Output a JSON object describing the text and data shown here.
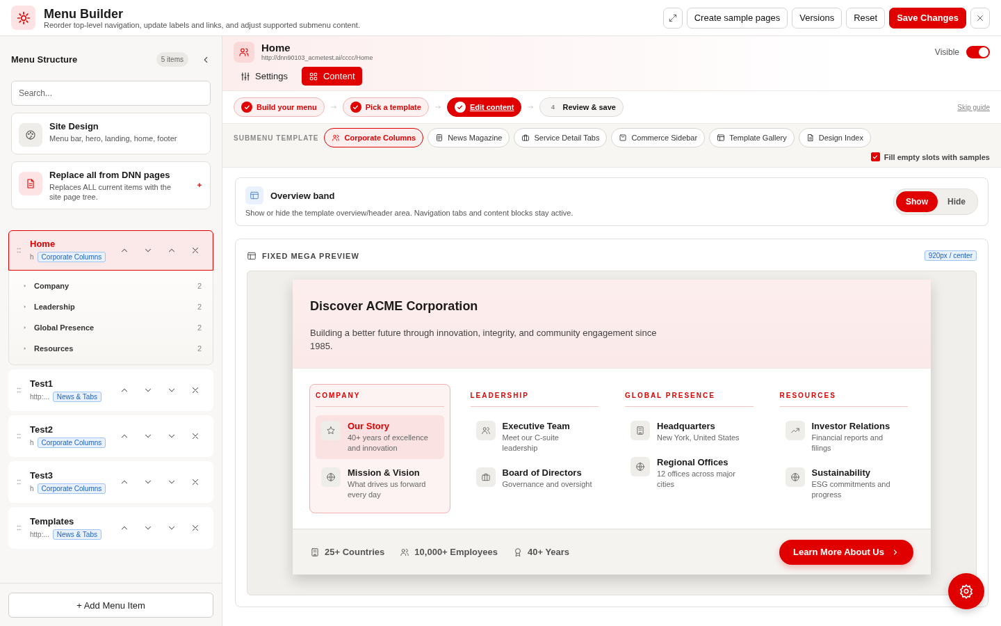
{
  "header": {
    "title": "Menu Builder",
    "subtitle": "Reorder top-level navigation, update labels and links, and adjust supported submenu content.",
    "buttons": [
      {
        "kind": "expand"
      },
      {
        "kind": "text",
        "label": "Create sample pages"
      },
      {
        "kind": "text",
        "label": "Versions"
      },
      {
        "kind": "text",
        "label": "Reset"
      },
      {
        "kind": "primary",
        "label": "Save Changes"
      },
      {
        "kind": "close"
      }
    ]
  },
  "sidebar": {
    "title": "Menu Structure",
    "count": "5 items",
    "search": {
      "placeholder": "Search..."
    },
    "actions": [
      {
        "kind": "palette",
        "title": "Site Design",
        "desc": "Menu bar, hero, landing, home, footer"
      },
      {
        "kind": "document",
        "title": "Replace all from DNN pages",
        "desc": "Replaces ALL current items with the site page tree."
      }
    ],
    "items": [
      {
        "title": "Home",
        "url": "h",
        "tag": "Corporate Columns",
        "selected": true,
        "controls": [
          {
            "kind": "up"
          },
          {
            "kind": "down"
          },
          {
            "kind": "up"
          },
          {
            "kind": "remove"
          }
        ],
        "children": [
          {
            "label": "Company",
            "count": "2"
          },
          {
            "label": "Leadership",
            "count": "2"
          },
          {
            "label": "Global Presence",
            "count": "2"
          },
          {
            "label": "Resources",
            "count": "2"
          }
        ]
      },
      {
        "title": "Test1",
        "url": "http:...",
        "tag": "News & Tabs",
        "selected": false,
        "controls": [
          {
            "kind": "up"
          },
          {
            "kind": "down"
          },
          {
            "kind": "down"
          },
          {
            "kind": "remove"
          }
        ]
      },
      {
        "title": "Test2",
        "url": "h",
        "tag": "Corporate Columns",
        "selected": false,
        "controls": [
          {
            "kind": "up"
          },
          {
            "kind": "down"
          },
          {
            "kind": "down"
          },
          {
            "kind": "remove"
          }
        ]
      },
      {
        "title": "Test3",
        "url": "h",
        "tag": "Corporate Columns",
        "selected": false,
        "controls": [
          {
            "kind": "up"
          },
          {
            "kind": "down"
          },
          {
            "kind": "down"
          },
          {
            "kind": "remove"
          }
        ]
      },
      {
        "title": "Templates",
        "url": "http:...",
        "tag": "News & Tabs",
        "selected": false,
        "controls": [
          {
            "kind": "up"
          },
          {
            "kind": "down"
          },
          {
            "kind": "down"
          },
          {
            "kind": "remove"
          }
        ]
      }
    ],
    "add_button": "+ Add Menu Item"
  },
  "editor": {
    "title": "Home",
    "url": "http://dnn90103_acmetest.ai/cccc/Home",
    "visible_label": "Visible",
    "visible": true,
    "tabs": [
      {
        "label": "Settings",
        "kind": "sliders",
        "selected": false
      },
      {
        "label": "Content",
        "kind": "grid",
        "selected": true
      }
    ]
  },
  "steps": [
    {
      "label": "Build your menu",
      "done": true,
      "selected": false
    },
    {
      "label": "Pick a template",
      "done": true,
      "selected": false
    },
    {
      "label": "Edit content",
      "done": true,
      "selected": true
    },
    {
      "number": "4",
      "label": "Review & save",
      "done": false,
      "selected": false
    }
  ],
  "skip_guide": "Skip guide",
  "template": {
    "label": "SUBMENU TEMPLATE",
    "options": [
      {
        "label": "Corporate Columns",
        "kind": "people",
        "selected": true
      },
      {
        "label": "News Magazine",
        "kind": "news",
        "selected": false
      },
      {
        "label": "Service Detail Tabs",
        "kind": "briefcase",
        "selected": false
      },
      {
        "label": "Commerce Sidebar",
        "kind": "bag",
        "selected": false
      },
      {
        "label": "Template Gallery",
        "kind": "layout",
        "selected": false
      },
      {
        "label": "Design Index",
        "kind": "document",
        "selected": false
      }
    ],
    "fill_samples": {
      "label": "Fill empty slots with samples",
      "checked": true
    }
  },
  "overview": {
    "title": "Overview band",
    "desc": "Show or hide the template overview/header area. Navigation tabs and content blocks stay active.",
    "options": [
      {
        "label": "Show",
        "selected": true
      },
      {
        "label": "Hide",
        "selected": false
      }
    ]
  },
  "preview": {
    "title": "FIXED MEGA PREVIEW",
    "size": "920px / center",
    "heading": "Discover ACME Corporation",
    "text": "Building a better future through innovation, integrity, and community engagement since 1985.",
    "columns": [
      {
        "title": "COMPANY",
        "selected": true,
        "links": [
          {
            "title": "Our Story",
            "desc": "40+ years of excellence and innovation",
            "kind": "star",
            "selected": true
          },
          {
            "title": "Mission & Vision",
            "desc": "What drives us forward every day",
            "kind": "globe",
            "selected": false
          }
        ]
      },
      {
        "title": "LEADERSHIP",
        "selected": false,
        "links": [
          {
            "title": "Executive Team",
            "desc": "Meet our C-suite leadership",
            "kind": "people",
            "selected": false
          },
          {
            "title": "Board of Directors",
            "desc": "Governance and oversight",
            "kind": "briefcase",
            "selected": false
          }
        ]
      },
      {
        "title": "GLOBAL PRESENCE",
        "selected": false,
        "links": [
          {
            "title": "Headquarters",
            "desc": "New York, United States",
            "kind": "building",
            "selected": false
          },
          {
            "title": "Regional Offices",
            "desc": "12 offices across major cities",
            "kind": "globe",
            "selected": false
          }
        ]
      },
      {
        "title": "RESOURCES",
        "selected": false,
        "links": [
          {
            "title": "Investor Relations",
            "desc": "Financial reports and filings",
            "kind": "trend",
            "selected": false
          },
          {
            "title": "Sustainability",
            "desc": "ESG commitments and progress",
            "kind": "globe",
            "selected": false
          }
        ]
      }
    ],
    "stats": [
      {
        "label": "25+ Countries",
        "kind": "building"
      },
      {
        "label": "10,000+ Employees",
        "kind": "people"
      },
      {
        "label": "40+ Years",
        "kind": "award"
      }
    ],
    "cta": "Learn More About Us"
  }
}
